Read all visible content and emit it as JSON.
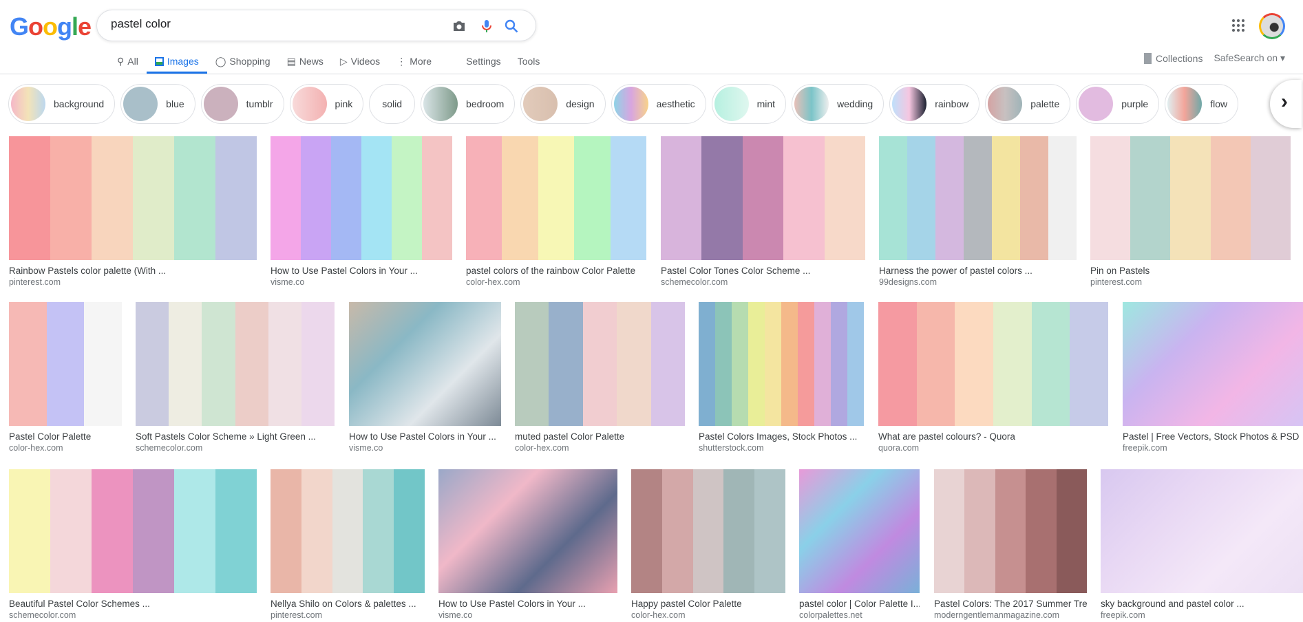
{
  "logo": "Google",
  "search": {
    "query": "pastel color"
  },
  "tabs": [
    {
      "label": "All",
      "icon": "search-icon"
    },
    {
      "label": "Images",
      "icon": "image-icon",
      "active": true
    },
    {
      "label": "Shopping",
      "icon": "tag-icon"
    },
    {
      "label": "News",
      "icon": "news-icon"
    },
    {
      "label": "Videos",
      "icon": "play-icon"
    },
    {
      "label": "More",
      "icon": "more-vert-icon"
    },
    {
      "label": "Settings"
    },
    {
      "label": "Tools"
    }
  ],
  "right_tools": {
    "collections": "Collections",
    "safesearch": "SafeSearch on"
  },
  "chips": [
    {
      "label": "background",
      "colors": [
        "#f5b8c8",
        "#f3e3b8",
        "#bcd8ef"
      ]
    },
    {
      "label": "blue",
      "colors": [
        "#a9bfc9",
        "#a9bfc9"
      ]
    },
    {
      "label": "tumblr",
      "colors": [
        "#cbb1bd",
        "#cbb1bd"
      ]
    },
    {
      "label": "pink",
      "colors": [
        "#f8dada",
        "#f3b1b1"
      ]
    },
    {
      "label": "solid",
      "colors": []
    },
    {
      "label": "bedroom",
      "colors": [
        "#d9e4e6",
        "#7e9a8a"
      ]
    },
    {
      "label": "design",
      "colors": [
        "#e2cbbb",
        "#d8bfae"
      ]
    },
    {
      "label": "aesthetic",
      "colors": [
        "#8fd3e6",
        "#d8a5e0",
        "#f8d38a"
      ]
    },
    {
      "label": "mint",
      "colors": [
        "#b6f0e0",
        "#dff7ef"
      ]
    },
    {
      "label": "wedding",
      "colors": [
        "#e8c0b8",
        "#7bc4c8",
        "#eee"
      ]
    },
    {
      "label": "rainbow",
      "colors": [
        "#bfe0fb",
        "#f5c6e0",
        "#1a2030"
      ]
    },
    {
      "label": "palette",
      "colors": [
        "#d4a3a3",
        "#c8c0c0",
        "#9fb4b8"
      ]
    },
    {
      "label": "purple",
      "colors": [
        "#e2bbe0",
        "#e2bbe0"
      ]
    },
    {
      "label": "flow",
      "colors": [
        "#e0eef0",
        "#f3a59a",
        "#6fa8a8"
      ]
    }
  ],
  "results": [
    {
      "title": "Rainbow Pastels color palette (With ...",
      "domain": "pinterest.com",
      "colors": [
        "#f7959a",
        "#f8b0a8",
        "#f8d5bd",
        "#e0ecc9",
        "#b2e5cf",
        "#c0c6e4"
      ]
    },
    {
      "title": "How to Use Pastel Colors in Your ...",
      "domain": "visme.co",
      "colors": [
        "#f4a6e8",
        "#c9a4f4",
        "#a4b8f4",
        "#a4e4f4",
        "#c4f4c4",
        "#f4c4c4"
      ]
    },
    {
      "title": "pastel colors of the rainbow Color Palette",
      "domain": "color-hex.com",
      "colors": [
        "#f7b1b8",
        "#f9d7b0",
        "#f7f7b5",
        "#b5f5bf",
        "#b5daf5"
      ]
    },
    {
      "title": "Pastel Color Tones Color Scheme ...",
      "domain": "schemecolor.com",
      "colors": [
        "#d8b4dc",
        "#9479a8",
        "#cb88b0",
        "#f6c1d0",
        "#f7d9c9"
      ]
    },
    {
      "title": "Harness the power of pastel colors ...",
      "domain": "99designs.com",
      "colors": [
        "#a7e3d6",
        "#a5d4e8",
        "#d4b8df",
        "#b4b8bd",
        "#f3e4a0",
        "#e9b9a8",
        "#f0f0f0"
      ]
    },
    {
      "title": "Pin on Pastels",
      "domain": "pinterest.com",
      "colors": [
        "#f5dde0",
        "#b3d4cc",
        "#f4e2b8",
        "#f3c7b5",
        "#e0ccd6"
      ]
    },
    {
      "title": "Pastel Color Palette",
      "domain": "color-hex.com",
      "colors": [
        "#f6b9b5",
        "#c4c2f5",
        "#f5f5f5"
      ]
    },
    {
      "title": "Soft Pastels Color Scheme » Light Green ...",
      "domain": "schemecolor.com",
      "colors": [
        "#cacbe0",
        "#eeede2",
        "#cfe5d2",
        "#eccdc8",
        "#f0e0e4",
        "#ecd8ec"
      ]
    },
    {
      "title": "How to Use Pastel Colors in Your ...",
      "domain": "visme.co",
      "photo": true,
      "colors": [
        "#c8b9a9",
        "#8ab8c5",
        "#e0e6ea",
        "#7d8a96"
      ]
    },
    {
      "title": "muted pastel Color Palette",
      "domain": "color-hex.com",
      "colors": [
        "#b8cbbd",
        "#98b0cb",
        "#f1cdd0",
        "#f0d8cb",
        "#d8c4e8"
      ]
    },
    {
      "title": "Pastel Colors Images, Stock Photos ...",
      "domain": "shutterstock.com",
      "colors": [
        "#7fafd0",
        "#8cc4b8",
        "#b6dcb0",
        "#e9ee98",
        "#f4e5a0",
        "#f4b98a",
        "#f59b9b",
        "#e0b0d8",
        "#b0a8e0",
        "#a0c8e8"
      ]
    },
    {
      "title": "What are pastel colours? - Quora",
      "domain": "quora.com",
      "colors": [
        "#f59aa1",
        "#f6b7ab",
        "#fcdac0",
        "#e3efcc",
        "#b6e5d2",
        "#c6cbe8"
      ]
    },
    {
      "title": "Pastel | Free Vectors, Stock Photos & PSD",
      "domain": "freepik.com",
      "photo": true,
      "colors": [
        "#9ee8e0",
        "#c9b4f0",
        "#f2b6e6",
        "#d6c4f4"
      ]
    },
    {
      "title": "Beautiful Pastel Color Schemes ...",
      "domain": "schemecolor.com",
      "colors": [
        "#f9f5b4",
        "#f4d7da",
        "#ec93bf",
        "#c095c4",
        "#aee8e8",
        "#80d2d4"
      ]
    },
    {
      "title": "Nellya Shilo on Colors & palettes ...",
      "domain": "pinterest.com",
      "colors": [
        "#e9b6a8",
        "#f2d6cb",
        "#e3e3de",
        "#a9d8d3",
        "#72c6c8"
      ]
    },
    {
      "title": "How to Use Pastel Colors in Your ...",
      "domain": "visme.co",
      "photo": true,
      "colors": [
        "#9aa8c8",
        "#f0b8c8",
        "#5e6a8c",
        "#e8a0b0"
      ]
    },
    {
      "title": "Happy pastel Color Palette",
      "domain": "color-hex.com",
      "colors": [
        "#b38484",
        "#d3a8a8",
        "#cfc4c4",
        "#a0b6b6",
        "#aec4c6"
      ]
    },
    {
      "title": "pastel color | Color Palette I...",
      "domain": "colorpalettes.net",
      "photo": true,
      "colors": [
        "#e89ad8",
        "#8ad0e8",
        "#c08ae0",
        "#7ab0d8"
      ]
    },
    {
      "title": "Pastel Colors: The 2017 Summer Tre...",
      "domain": "moderngentlemanmagazine.com",
      "colors": [
        "#e8d3d3",
        "#dcb8b8",
        "#c69090",
        "#a87070",
        "#8a5a5a"
      ]
    },
    {
      "title": "sky background and pastel color ...",
      "domain": "freepik.com",
      "photo": true,
      "colors": [
        "#d8c8f0",
        "#e8d8f4",
        "#f4e8f8",
        "#ece0f4"
      ]
    }
  ]
}
